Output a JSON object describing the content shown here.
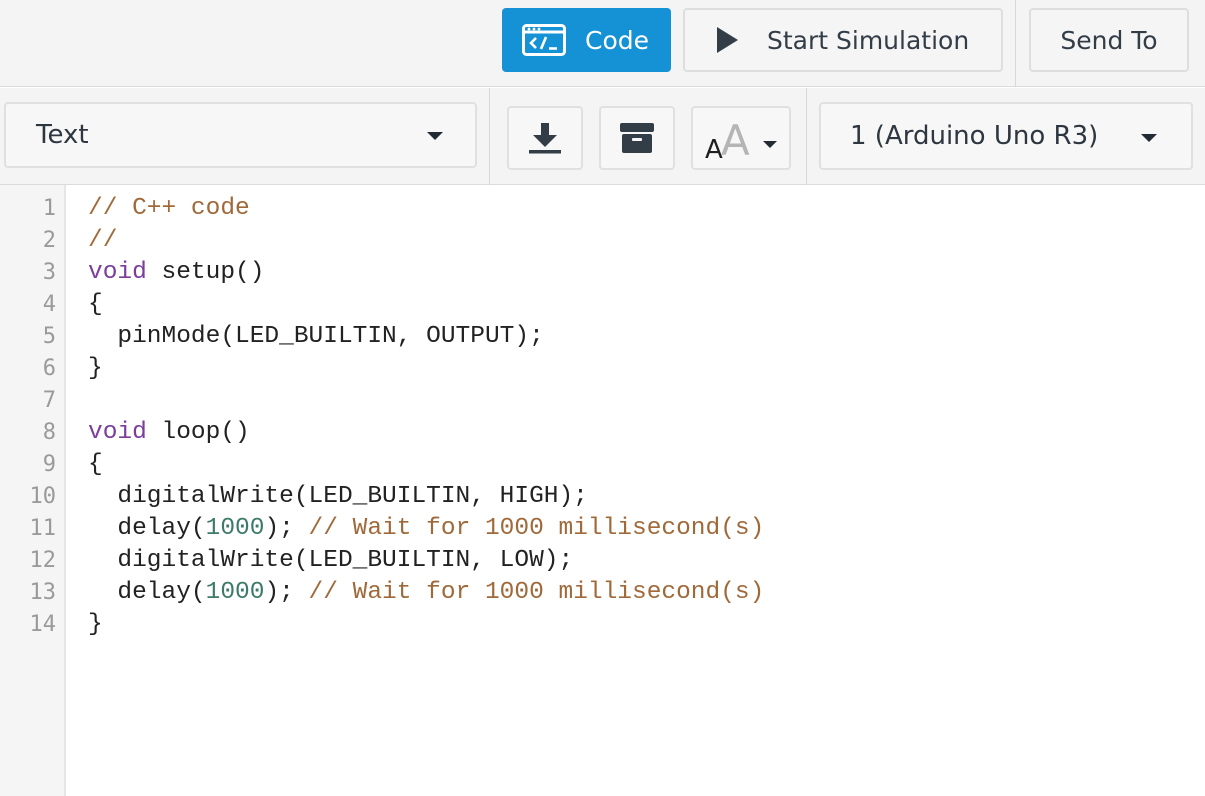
{
  "header": {
    "code_label": "Code",
    "start_simulation_label": "Start Simulation",
    "send_to_label": "Send To"
  },
  "toolbar": {
    "mode_value": "Text",
    "board_value": "1 (Arduino Uno R3)"
  },
  "editor": {
    "line_numbers": [
      "1",
      "2",
      "3",
      "4",
      "5",
      "6",
      "7",
      "8",
      "9",
      "10",
      "11",
      "12",
      "13",
      "14"
    ],
    "lines": [
      [
        {
          "t": "// C++ code",
          "c": "comment"
        }
      ],
      [
        {
          "t": "//",
          "c": "comment"
        }
      ],
      [
        {
          "t": "void",
          "c": "kw"
        },
        {
          "t": " setup()",
          "c": "plain"
        }
      ],
      [
        {
          "t": "{",
          "c": "plain"
        }
      ],
      [
        {
          "t": "  pinMode(LED_BUILTIN, OUTPUT);",
          "c": "plain"
        }
      ],
      [
        {
          "t": "}",
          "c": "plain"
        }
      ],
      [],
      [
        {
          "t": "void",
          "c": "kw"
        },
        {
          "t": " loop()",
          "c": "plain"
        }
      ],
      [
        {
          "t": "{",
          "c": "plain"
        }
      ],
      [
        {
          "t": "  digitalWrite(LED_BUILTIN, HIGH);",
          "c": "plain"
        }
      ],
      [
        {
          "t": "  delay(",
          "c": "plain"
        },
        {
          "t": "1000",
          "c": "num"
        },
        {
          "t": "); ",
          "c": "plain"
        },
        {
          "t": "// Wait for 1000 millisecond(s)",
          "c": "comment"
        }
      ],
      [
        {
          "t": "  digitalWrite(LED_BUILTIN, LOW);",
          "c": "plain"
        }
      ],
      [
        {
          "t": "  delay(",
          "c": "plain"
        },
        {
          "t": "1000",
          "c": "num"
        },
        {
          "t": "); ",
          "c": "plain"
        },
        {
          "t": "// Wait for 1000 millisecond(s)",
          "c": "comment"
        }
      ],
      [
        {
          "t": "}",
          "c": "plain"
        }
      ]
    ]
  },
  "colors": {
    "accent": "#1591d6",
    "comment": "#a0693a",
    "keyword": "#7a3e9d",
    "number": "#3c7a6a"
  },
  "icons": {
    "code": "code-window-icon",
    "play": "play-icon",
    "download": "download-icon",
    "components": "components-box-icon",
    "font_size": "font-size-icon"
  }
}
